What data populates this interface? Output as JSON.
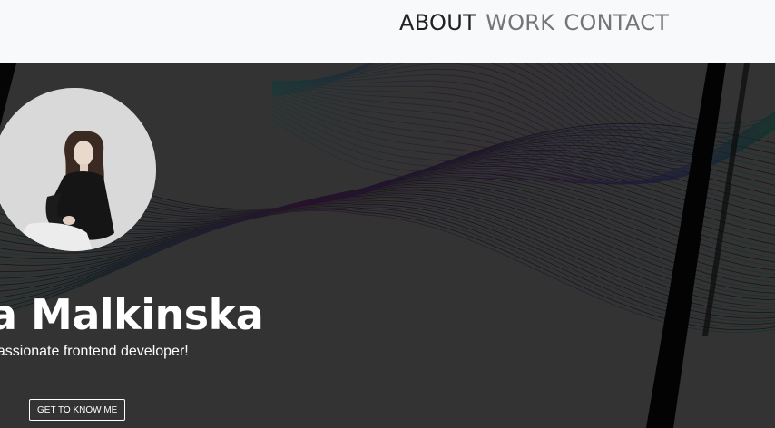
{
  "nav": {
    "items": [
      {
        "label": "ABOUT",
        "active": true
      },
      {
        "label": "WORK",
        "active": false
      },
      {
        "label": "CONTACT",
        "active": false
      }
    ]
  },
  "hero": {
    "name": "a Malkinska",
    "tagline": "passionate frontend developer!",
    "cta_label": "GET TO KNOW ME",
    "avatar_icon": "profile-photo"
  },
  "colors": {
    "nav_background": "#f8f9fa",
    "nav_active": "#212121",
    "nav_inactive": "#757575",
    "hero_background": "#333333",
    "hero_text": "#ffffff"
  }
}
